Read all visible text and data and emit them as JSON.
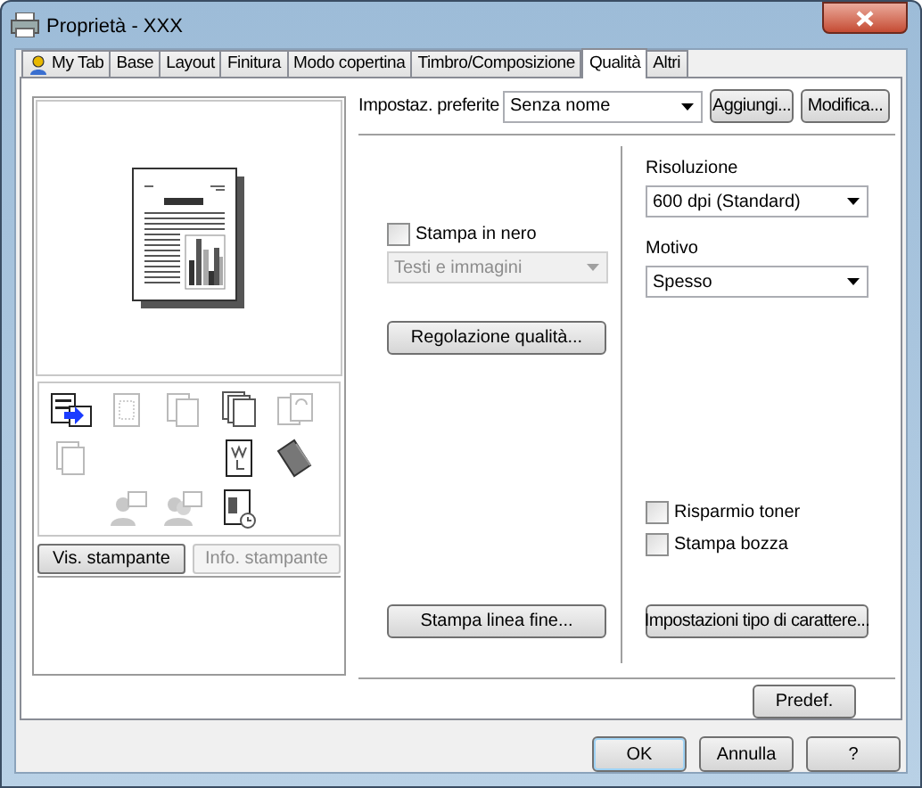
{
  "window": {
    "title": "Proprietà - XXX"
  },
  "tabs": [
    {
      "label": "My Tab",
      "selected": false,
      "kind": "icon"
    },
    {
      "label": "Base",
      "selected": false
    },
    {
      "label": "Layout",
      "selected": false
    },
    {
      "label": "Finitura",
      "selected": false
    },
    {
      "label": "Modo copertina",
      "selected": false
    },
    {
      "label": "Timbro/Composizione",
      "selected": false
    },
    {
      "label": "Qualità",
      "selected": true
    },
    {
      "label": "Altri",
      "selected": false
    }
  ],
  "preview_buttons": [
    {
      "label": "Vis. stampante",
      "disabled": false
    },
    {
      "label": "Info. stampante",
      "disabled": true
    }
  ],
  "favorites": {
    "label": "Impostaz. preferite",
    "value": "Senza nome",
    "buttons": [
      "Aggiungi...",
      "Modifica..."
    ]
  },
  "left": {
    "black_print": {
      "label": "Stampa in nero",
      "checked": false
    },
    "mode": {
      "value": "Testi e immagini",
      "disabled": true
    },
    "quality_button": "Regolazione qualità...",
    "fine_line_button": "Stampa linea fine..."
  },
  "right": {
    "resolution": {
      "label": "Risoluzione",
      "value": "600 dpi (Standard)"
    },
    "pattern": {
      "label": "Motivo",
      "value": "Spesso"
    },
    "checkboxes": [
      {
        "label": "Risparmio toner",
        "checked": false
      },
      {
        "label": "Stampa bozza",
        "checked": false
      }
    ],
    "font_button": "Impostazioni tipo di carattere..."
  },
  "default_button": "Predef.",
  "dialog_buttons": [
    {
      "label": "OK",
      "selected": true
    },
    {
      "label": "Annulla",
      "selected": false
    },
    {
      "label": "?",
      "selected": false
    }
  ]
}
